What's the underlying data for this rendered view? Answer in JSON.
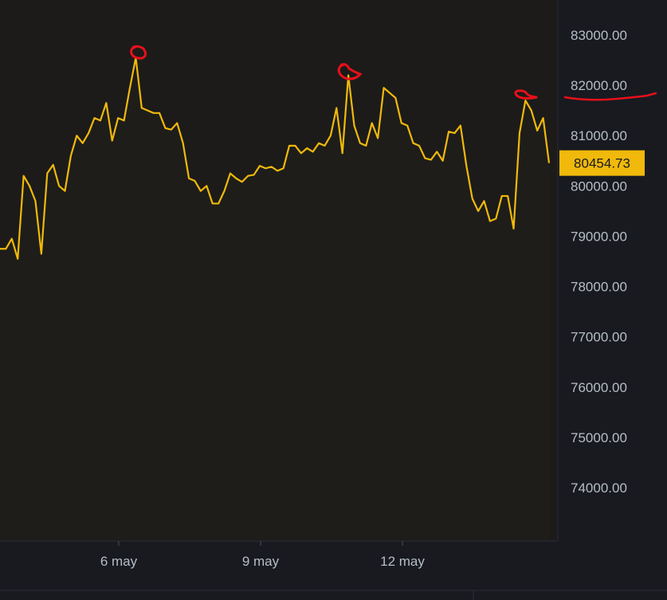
{
  "chart_data": {
    "type": "area",
    "x_tick_labels": [
      "6 may",
      "9 may",
      "12 may"
    ],
    "y_tick_values": [
      74000,
      75000,
      76000,
      77000,
      78000,
      79000,
      80000,
      81000,
      82000,
      83000
    ],
    "y_tick_labels": [
      "74000.00",
      "75000.00",
      "76000.00",
      "77000.00",
      "78000.00",
      "79000.00",
      "80000.00",
      "81000.00",
      "82000.00",
      "83000.00"
    ],
    "ylim": [
      73000,
      83500
    ],
    "current_price": 80454.73,
    "current_price_label": "80454.73",
    "series": [
      {
        "values": [
          78750,
          78750,
          78950,
          78550,
          80200,
          80000,
          79700,
          78650,
          80250,
          80420,
          80000,
          79900,
          80600,
          81000,
          80850,
          81050,
          81350,
          81300,
          81650,
          80900,
          81350,
          81300,
          81950,
          82550,
          81550,
          81500,
          81450,
          81450,
          81150,
          81120,
          81250,
          80850,
          80150,
          80100,
          79900,
          80000,
          79650,
          79650,
          79900,
          80250,
          80150,
          80080,
          80200,
          80220,
          80400,
          80350,
          80380,
          80300,
          80350,
          80800,
          80800,
          80650,
          80750,
          80680,
          80850,
          80800,
          81000,
          81550,
          80650,
          82200,
          81200,
          80850,
          80800,
          81250,
          80950,
          81950,
          81850,
          81750,
          81250,
          81200,
          80850,
          80800,
          80550,
          80520,
          80680,
          80500,
          81080,
          81050,
          81200,
          80400,
          79750,
          79500,
          79700,
          79300,
          79350,
          79800,
          79800,
          79150,
          81050,
          81700,
          81500,
          81100,
          81350,
          80454.73
        ]
      }
    ],
    "colors": {
      "background": "#181a20",
      "plot_fill": "#1e1d1a",
      "line": "#f0b90b",
      "axis_text": "#b7bdc6",
      "annotation": "#e8101a",
      "price_tag": "#f0b90b"
    }
  }
}
